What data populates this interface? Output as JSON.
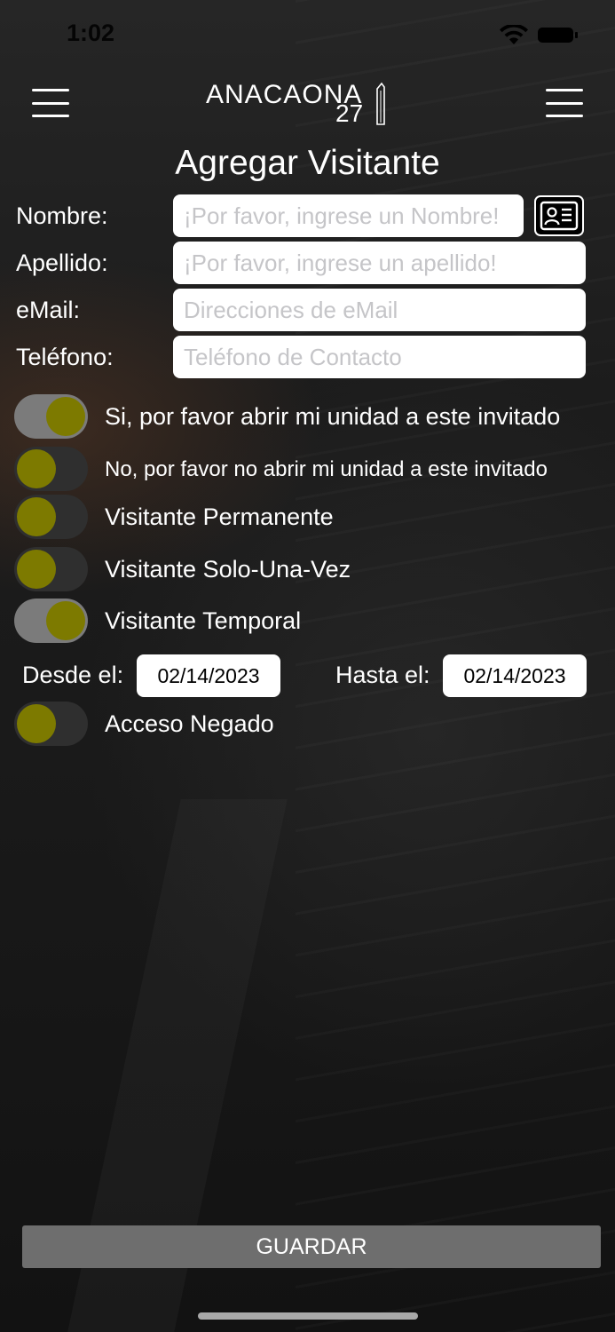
{
  "status_bar": {
    "time": "1:02"
  },
  "header": {
    "logo_text": "ANACAONA",
    "logo_number": "27"
  },
  "page": {
    "title": "Agregar Visitante"
  },
  "form": {
    "nombre": {
      "label": "Nombre:",
      "placeholder": "¡Por favor, ingrese un Nombre!",
      "value": ""
    },
    "apellido": {
      "label": "Apellido:",
      "placeholder": "¡Por favor, ingrese un apellido!",
      "value": ""
    },
    "email": {
      "label": "eMail:",
      "placeholder": "Direcciones de eMail",
      "value": ""
    },
    "telefono": {
      "label": "Teléfono:",
      "placeholder": "Teléfono de Contacto",
      "value": ""
    }
  },
  "toggles": [
    {
      "label": "Si, por favor abrir mi unidad a este invitado",
      "on": true
    },
    {
      "label": "No, por favor no abrir mi unidad a este invitado",
      "on": false
    },
    {
      "label": "Visitante Permanente",
      "on": false
    },
    {
      "label": "Visitante Solo-Una-Vez",
      "on": false
    },
    {
      "label": "Visitante Temporal",
      "on": true
    },
    {
      "label": "Acceso Negado",
      "on": false
    }
  ],
  "dates": {
    "from_label": "Desde el:",
    "from_value": "02/14/2023",
    "to_label": "Hasta el:",
    "to_value": "02/14/2023"
  },
  "actions": {
    "save_label": "GUARDAR"
  },
  "colors": {
    "toggle_knob": "#7d7a00",
    "toggle_on_track": "#7b7b7b",
    "toggle_off_track": "#2f2f2f",
    "save_button": "#6e6e6e"
  },
  "icons": {
    "menu_left": "hamburger-menu-icon",
    "menu_right": "hamburger-menu-icon",
    "contact_card": "contact-card-icon",
    "wifi": "wifi-icon",
    "battery": "battery-icon"
  }
}
